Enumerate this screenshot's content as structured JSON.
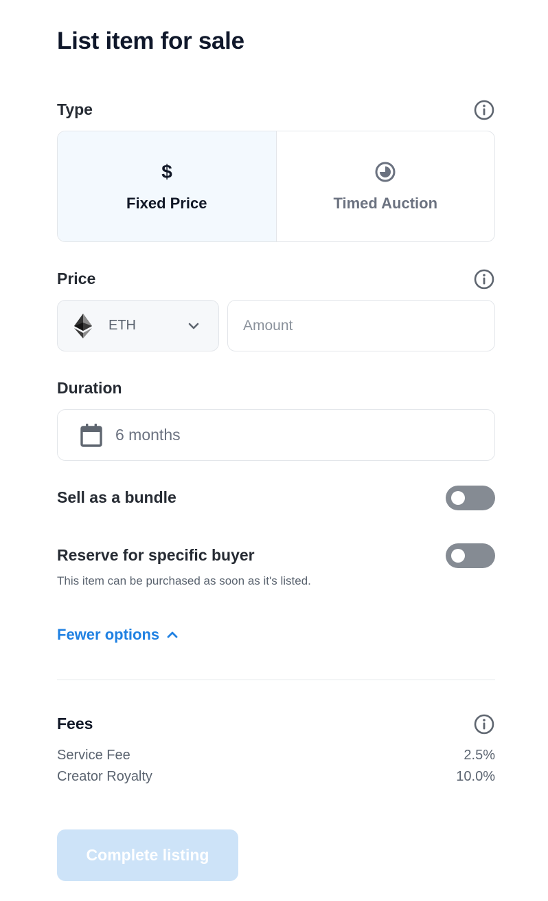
{
  "page": {
    "title": "List item for sale"
  },
  "type": {
    "label": "Type",
    "options": [
      {
        "label": "Fixed Price",
        "icon": "dollar-icon",
        "selected": true
      },
      {
        "label": "Timed Auction",
        "icon": "clock-icon",
        "selected": false
      }
    ]
  },
  "price": {
    "label": "Price",
    "currency": "ETH",
    "currency_icon": "eth-icon",
    "amount_value": "",
    "amount_placeholder": "Amount"
  },
  "duration": {
    "label": "Duration",
    "value": "6 months",
    "icon": "calendar-icon"
  },
  "bundle": {
    "label": "Sell as a bundle",
    "enabled": false
  },
  "reserve": {
    "label": "Reserve for specific buyer",
    "enabled": false,
    "hint": "This item can be purchased as soon as it's listed."
  },
  "options_toggle": {
    "label": "Fewer options"
  },
  "fees": {
    "label": "Fees",
    "rows": [
      {
        "name": "Service Fee",
        "value": "2.5%"
      },
      {
        "name": "Creator Royalty",
        "value": "10.0%"
      }
    ]
  },
  "actions": {
    "complete_label": "Complete listing",
    "complete_enabled": false
  },
  "colors": {
    "accent": "#2081e2",
    "toggle_off": "#858b93",
    "button_disabled": "#cde3f8",
    "selected_bg": "#f3f9fe"
  }
}
